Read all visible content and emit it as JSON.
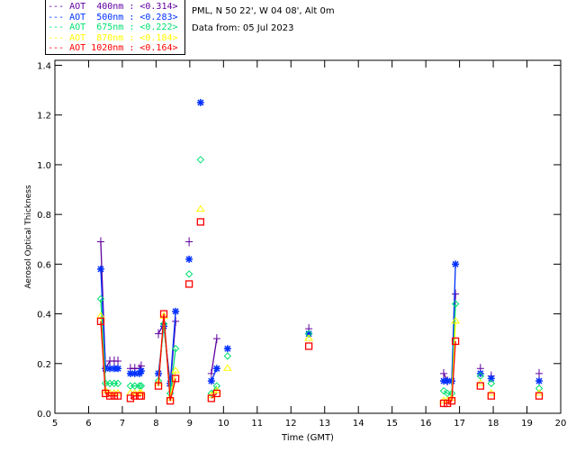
{
  "header": {
    "site": "PML, N 50 22', W 04 08', Alt 0m",
    "date": "Data from: 05 Jul 2023"
  },
  "chart_data": {
    "type": "line",
    "xlabel": "Time (GMT)",
    "ylabel": "Aerosol Optical Thickness",
    "xlim": [
      5,
      20
    ],
    "ylim": [
      0,
      1.42
    ],
    "xticks": [
      5,
      6,
      7,
      8,
      9,
      10,
      11,
      12,
      13,
      14,
      15,
      16,
      17,
      18,
      19,
      20
    ],
    "yticks": [
      "0.0",
      "0.2",
      "0.4",
      "0.6",
      "0.8",
      "1.0",
      "1.2",
      "1.4"
    ],
    "legend_placement": "top-left",
    "x": [
      6.36,
      6.5,
      6.63,
      6.76,
      6.87,
      7.24,
      7.37,
      7.51,
      7.56,
      8.07,
      8.23,
      8.42,
      8.58,
      8.98,
      9.32,
      9.64,
      9.8,
      10.12,
      12.53,
      16.53,
      16.64,
      16.77,
      16.88,
      17.62,
      17.94,
      19.36
    ],
    "series": [
      {
        "name": "AOT  400nm : <0.314>",
        "color": "#6000a0",
        "marker": "plus",
        "values": [
          0.69,
          0.18,
          0.21,
          0.21,
          0.21,
          0.18,
          0.18,
          0.18,
          0.19,
          0.32,
          0.36,
          0.11,
          0.37,
          0.69,
          null,
          0.16,
          0.3,
          null,
          0.34,
          0.16,
          0.13,
          0.13,
          0.48,
          0.18,
          0.15,
          0.16
        ]
      },
      {
        "name": "AOT  500nm : <0.283>",
        "color": "#0030ff",
        "marker": "asterisk",
        "values": [
          0.58,
          0.18,
          0.18,
          0.18,
          0.18,
          0.16,
          0.16,
          0.16,
          0.17,
          0.16,
          0.35,
          0.12,
          0.41,
          0.62,
          1.25,
          0.13,
          0.18,
          0.26,
          0.32,
          0.13,
          0.13,
          0.13,
          0.6,
          0.16,
          0.14,
          0.13
        ]
      },
      {
        "name": "AOT  675nm : <0.222>",
        "color": "#00e070",
        "marker": "diamond",
        "values": [
          0.46,
          0.12,
          0.12,
          0.12,
          0.12,
          0.11,
          0.11,
          0.11,
          0.11,
          0.13,
          0.36,
          0.08,
          0.26,
          0.56,
          1.02,
          0.08,
          0.11,
          0.23,
          0.32,
          0.09,
          0.08,
          0.08,
          0.44,
          0.15,
          0.12,
          0.1
        ]
      },
      {
        "name": "AOT  870nm : <0.184>",
        "color": "#ffff00",
        "marker": "triangle",
        "values": [
          0.39,
          0.09,
          0.08,
          0.08,
          0.08,
          0.08,
          0.08,
          0.08,
          0.08,
          0.12,
          0.39,
          0.06,
          0.17,
          null,
          0.82,
          0.07,
          0.09,
          0.18,
          0.3,
          0.05,
          0.05,
          0.06,
          0.37,
          0.12,
          0.08,
          0.08
        ]
      },
      {
        "name": "AOT 1020nm : <0.164>",
        "color": "#ff0000",
        "marker": "square",
        "values": [
          0.37,
          0.08,
          0.07,
          0.07,
          0.07,
          0.06,
          0.07,
          0.07,
          0.07,
          0.11,
          0.4,
          0.05,
          0.14,
          0.52,
          0.77,
          0.06,
          0.08,
          null,
          0.27,
          0.04,
          0.04,
          0.05,
          0.29,
          0.11,
          0.07,
          0.07
        ]
      }
    ]
  }
}
